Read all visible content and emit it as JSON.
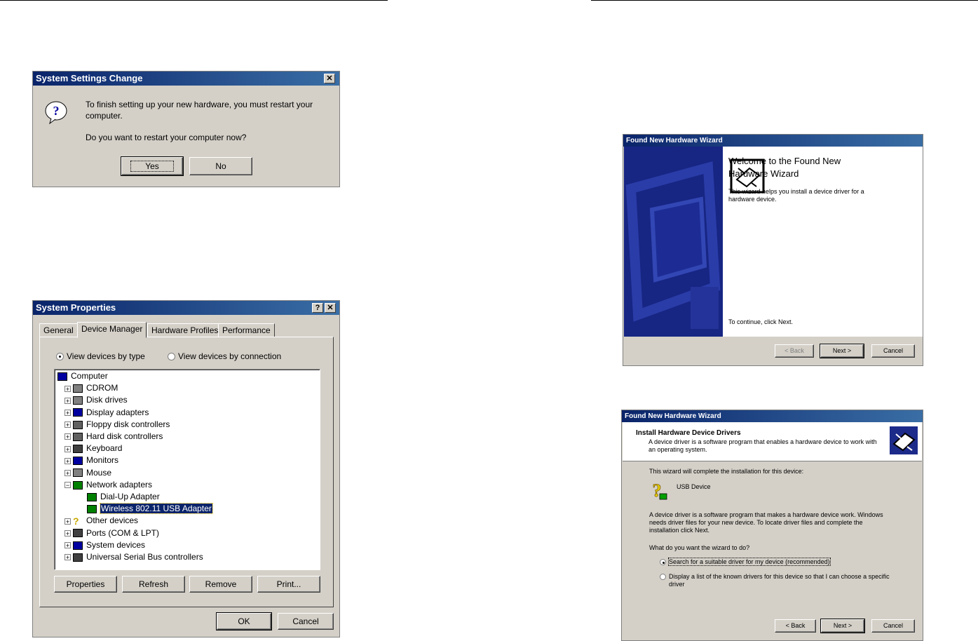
{
  "dlg_restart": {
    "title": "System Settings Change",
    "message1": "To finish setting up your new hardware, you must restart your",
    "message2": "computer.",
    "question": "Do you want to restart your computer now?",
    "yes": "Yes",
    "no": "No"
  },
  "sysprops": {
    "title": "System Properties",
    "tabs": [
      "General",
      "Device Manager",
      "Hardware Profiles",
      "Performance"
    ],
    "radio_type": "View devices by type",
    "radio_conn": "View devices by connection",
    "tree": [
      {
        "label": "Computer",
        "icon": "computer-icon"
      },
      {
        "label": "CDROM",
        "icon": "cdrom-icon"
      },
      {
        "label": "Disk drives",
        "icon": "disk-drive-icon"
      },
      {
        "label": "Display adapters",
        "icon": "monitor-icon"
      },
      {
        "label": "Floppy disk controllers",
        "icon": "floppy-icon"
      },
      {
        "label": "Hard disk controllers",
        "icon": "hard-disk-icon"
      },
      {
        "label": "Keyboard",
        "icon": "keyboard-icon"
      },
      {
        "label": "Monitors",
        "icon": "monitor-icon"
      },
      {
        "label": "Mouse",
        "icon": "mouse-icon"
      },
      {
        "label": "Network adapters",
        "icon": "network-card-icon"
      },
      {
        "label": "Dial-Up Adapter",
        "icon": "network-card-icon"
      },
      {
        "label": "Wireless 802.11 USB Adapter",
        "icon": "network-card-icon"
      },
      {
        "label": "Other devices",
        "icon": "question-icon"
      },
      {
        "label": "Ports (COM & LPT)",
        "icon": "port-icon"
      },
      {
        "label": "System devices",
        "icon": "computer-icon"
      },
      {
        "label": "Universal Serial Bus controllers",
        "icon": "usb-icon"
      }
    ],
    "btn_properties": "Properties",
    "btn_refresh": "Refresh",
    "btn_remove": "Remove",
    "btn_print": "Print...",
    "ok": "OK",
    "cancel": "Cancel"
  },
  "wizard1": {
    "title": "Found New Hardware Wizard",
    "heading1": "Welcome to the Found New",
    "heading2": "Hardware Wizard",
    "desc1": "This wizard helps you install a device driver for a",
    "desc2": "hardware device.",
    "continue": "To continue, click Next.",
    "back": "< Back",
    "next": "Next >",
    "cancel": "Cancel"
  },
  "wizard2": {
    "title": "Found New Hardware Wizard",
    "header": "Install Hardware Device Drivers",
    "header_desc1": "A device driver is a software program that enables a hardware device to work with",
    "header_desc2": "an operating system.",
    "intro": "This wizard will complete the installation for this device:",
    "device": "USB Device",
    "para1": "A device driver is a software program that makes a hardware device work. Windows",
    "para2": "needs driver files for your new device. To locate driver files and complete the",
    "para3": "installation click Next.",
    "question": "What do you want the wizard to do?",
    "opt1": "Search for a suitable driver for my device (recommended)",
    "opt2a": "Display a list of the known drivers for this device so that I can choose a specific",
    "opt2b": "driver",
    "back": "< Back",
    "next": "Next >",
    "cancel": "Cancel"
  }
}
